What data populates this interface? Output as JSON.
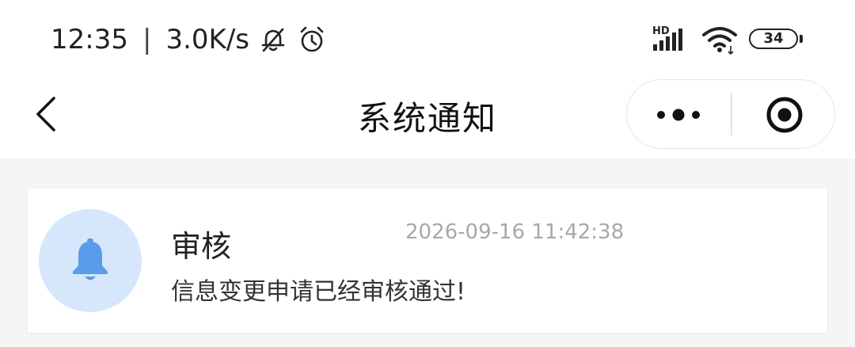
{
  "status_bar": {
    "time": "12:35",
    "separator": "|",
    "network_speed": "3.0K/s",
    "icons": [
      "bell-off-icon",
      "alarm-clock-icon",
      "hd-signal-icon",
      "wifi-icon",
      "battery-icon"
    ],
    "signal_label": "HD",
    "battery_level": "34"
  },
  "nav_bar": {
    "title": "系统通知",
    "back_icon": "chevron-left-icon",
    "more_icon": "more-dots-icon",
    "close_icon": "target-circle-icon"
  },
  "notifications": [
    {
      "icon": "bell-icon",
      "icon_color": "#5b9bec",
      "avatar_bg": "#d6e7fb",
      "title": "审核",
      "time": "2026-09-16 11:42:38",
      "message": "信息变更申请已经审核通过!"
    }
  ]
}
